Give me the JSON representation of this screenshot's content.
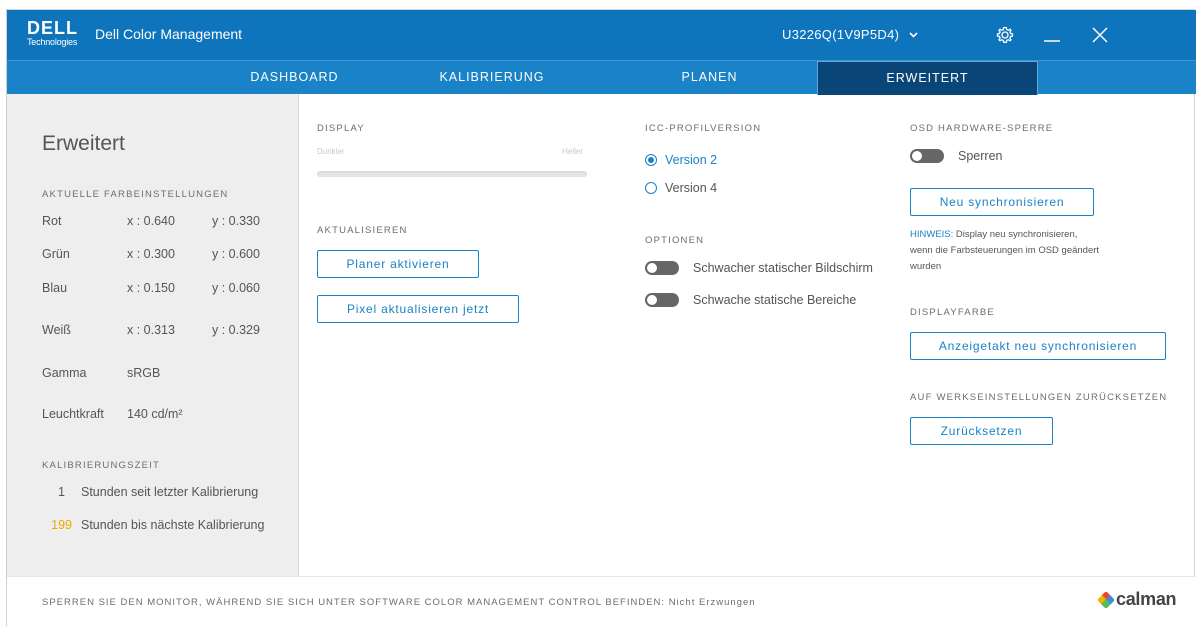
{
  "brand": {
    "logo_main": "DELL",
    "logo_sub": "Technologies"
  },
  "header": {
    "title": "Dell Color Management",
    "monitor": "U3226Q(1V9P5D4)",
    "icons": [
      "gear-icon",
      "minimize-icon",
      "close-icon"
    ]
  },
  "tabs": [
    {
      "label": "DASHBOARD"
    },
    {
      "label": "KALIBRIERUNG"
    },
    {
      "label": "PLANEN"
    },
    {
      "label": "ERWEITERT",
      "active": true
    }
  ],
  "sidebar": {
    "title": "Erweitert",
    "current_label": "AKTUELLE FARBEINSTELLUNGEN",
    "colors": [
      {
        "name": "Rot",
        "x": "x : 0.640",
        "y": "y : 0.330"
      },
      {
        "name": "Grün",
        "x": "x : 0.300",
        "y": "y : 0.600"
      },
      {
        "name": "Blau",
        "x": "x : 0.150",
        "y": "y : 0.060"
      },
      {
        "name": "Weiß",
        "x": "x : 0.313",
        "y": "y : 0.329"
      }
    ],
    "gamma_label": "Gamma",
    "gamma_value": "sRGB",
    "luminance_label": "Leuchtkraft",
    "luminance_value": "140 cd/m²",
    "calibration_label": "KALIBRIERUNGSZEIT",
    "since_count": "1",
    "since_text": "Stunden seit letzter Kalibrierung",
    "next_count": "199",
    "next_text": "Stunden bis nächste Kalibrierung"
  },
  "display": {
    "label": "DISPLAY",
    "slider_min": "Dunkler",
    "slider_max": "Heller"
  },
  "refresh": {
    "label": "AKTUALISIEREN",
    "planner_button": "Planer aktivieren",
    "pixel_button": "Pixel aktualisieren jetzt"
  },
  "icc": {
    "label": "ICC-PROFILVERSION",
    "options": [
      {
        "label": "Version 2",
        "selected": true
      },
      {
        "label": "Version 4",
        "selected": false
      }
    ]
  },
  "options": {
    "label": "OPTIONEN",
    "toggles": [
      {
        "label": "Schwacher statischer Bildschirm",
        "on": false
      },
      {
        "label": "Schwache statische Bereiche",
        "on": false
      }
    ]
  },
  "osd": {
    "label": "OSD HARDWARE-SPERRE",
    "toggle_label": "Sperren",
    "toggle_on": false,
    "resync_button": "Neu synchronisieren",
    "hint_prefix": "HINWEIS:",
    "hint_text": " Display neu synchronisieren, wenn die Farbsteuerungen im OSD geändert wurden"
  },
  "display_color": {
    "label": "DISPLAYFARBE",
    "button": "Anzeigetakt neu synchronisieren"
  },
  "factory": {
    "label": "AUF WERKSEINSTELLUNGEN ZURÜCKSETZEN",
    "button": "Zurücksetzen"
  },
  "footer": {
    "text": "SPERREN SIE DEN MONITOR, WÄHREND SIE SICH UNTER SOFTWARE COLOR MANAGEMENT CONTROL BEFINDEN:",
    "status": "Nicht Erzwungen",
    "brand": "calman"
  },
  "colors": {
    "header": "#0e74bc",
    "tabs": "#1a82c6",
    "active_tab": "#0a4577",
    "accent": "#1a82c6",
    "warning": "#f0a500"
  }
}
